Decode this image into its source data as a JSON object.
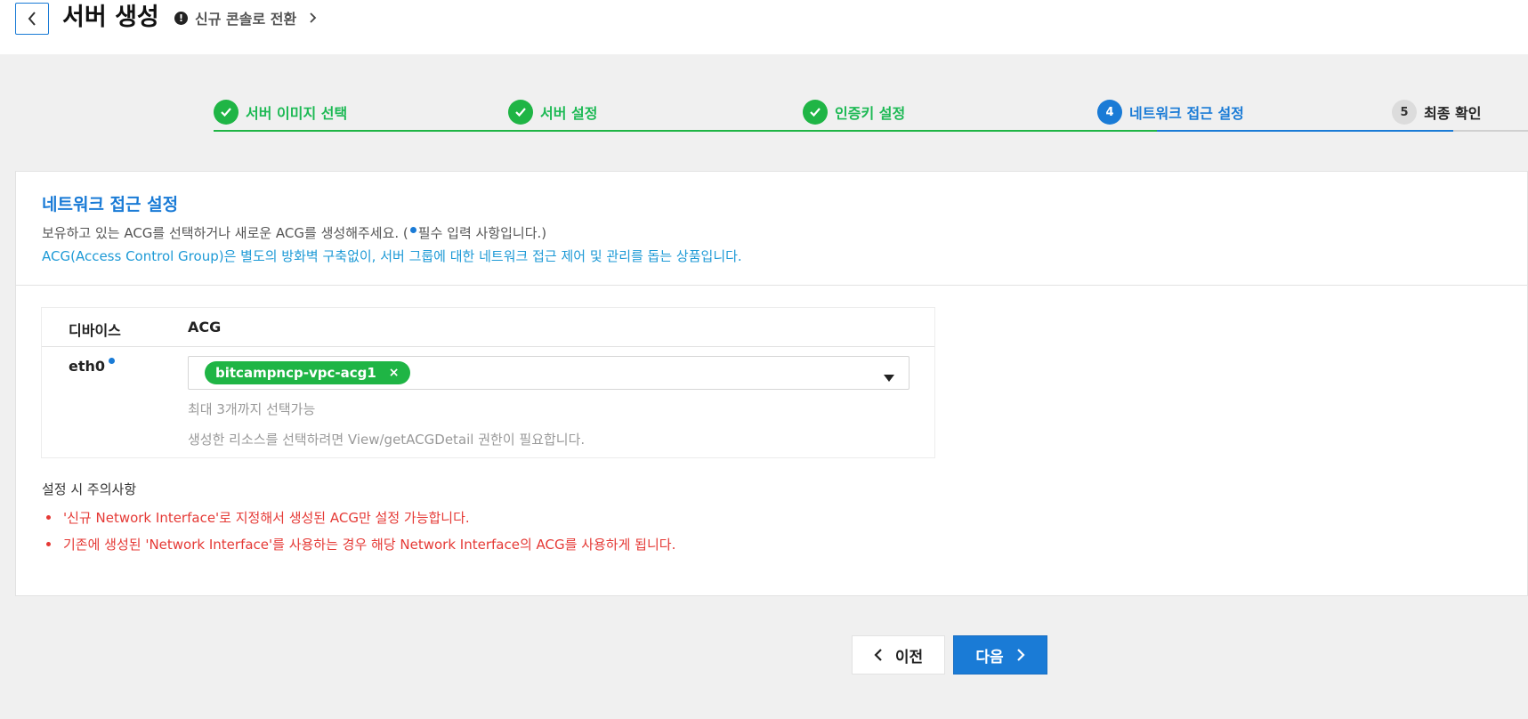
{
  "header": {
    "title": "서버 생성",
    "switch_label": "신규 콘솔로 전환",
    "info_glyph": "!"
  },
  "steps": [
    {
      "label": "서버 이미지 선택",
      "status": "done",
      "marker": "✓"
    },
    {
      "label": "서버 설정",
      "status": "done",
      "marker": "✓"
    },
    {
      "label": "인증키 설정",
      "status": "done",
      "marker": "✓"
    },
    {
      "label": "네트워크 접근 설정",
      "status": "active",
      "marker": "4"
    },
    {
      "label": "최종 확인",
      "status": "pending",
      "marker": "5"
    }
  ],
  "section": {
    "title": "네트워크 접근 설정",
    "desc_prefix": "보유하고 있는 ACG를 선택하거나 새로운 ACG를 생성해주세요. (",
    "desc_suffix": "필수 입력 사항입니다.)",
    "desc_acg": "ACG(Access Control Group)은 별도의 방화벽 구축없이, 서버 그룹에 대한 네트워크 접근 제어 및 관리를 돕는 상품입니다."
  },
  "acg_table": {
    "col_device": "디바이스",
    "col_acg": "ACG",
    "device": "eth0",
    "selected_tag": "bitcampncp-vpc-acg1",
    "tag_remove": "×",
    "hint_max": "최대 3개까지 선택가능",
    "hint_perm": "생성한 리소스를 선택하려면 View/getACGDetail 권한이 필요합니다."
  },
  "notes": {
    "title": "설정 시 주의사항",
    "items": [
      "'신규 Network Interface'로 지정해서 생성된 ACG만 설정 가능합니다.",
      "기존에 생성된 'Network Interface'를 사용하는 경우 해당 Network Interface의 ACG를 사용하게 됩니다."
    ]
  },
  "footer": {
    "prev_label": "이전",
    "next_label": "다음"
  },
  "colors": {
    "primary": "#1a7bd6",
    "success": "#1fb545",
    "danger": "#e53935"
  }
}
